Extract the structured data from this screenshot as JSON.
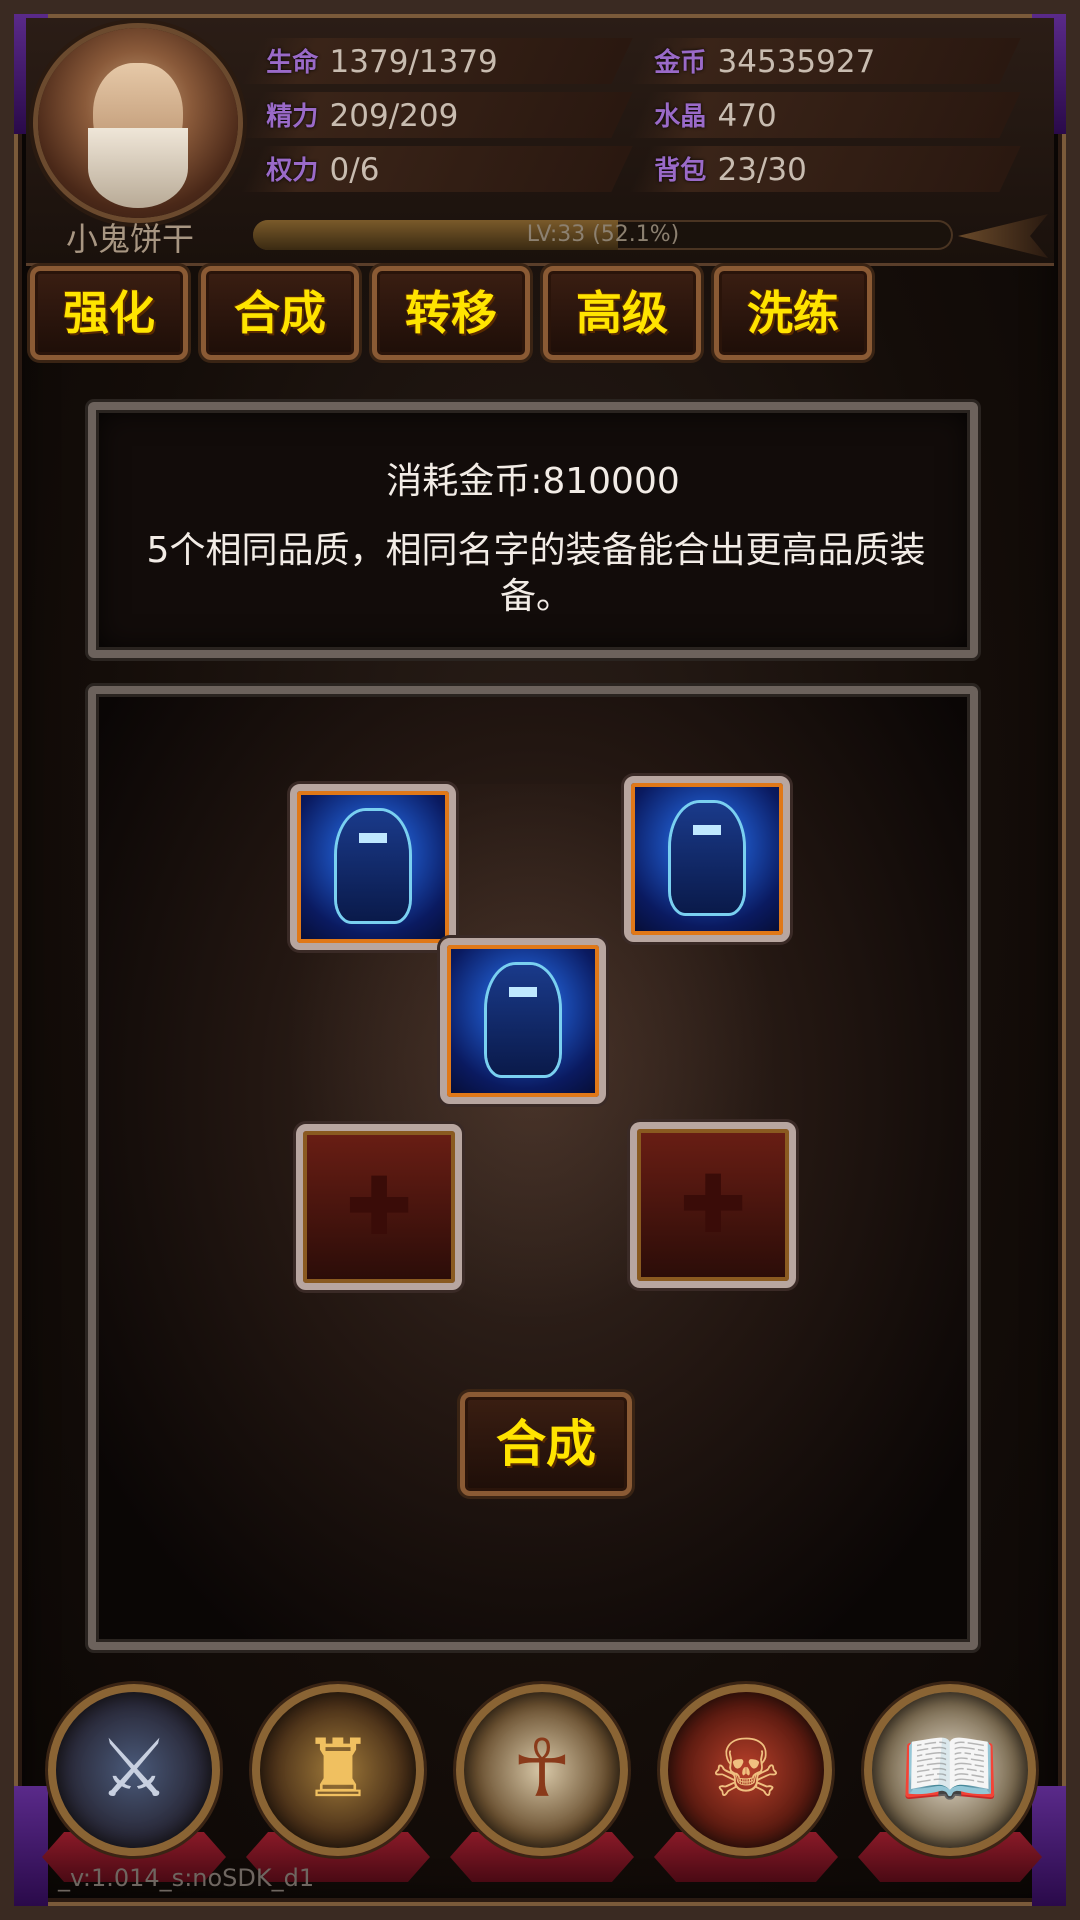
{
  "player": {
    "name": "小鬼饼干",
    "level_text": "LV:33 (52.1%)",
    "level_progress": 0.521
  },
  "stats": [
    {
      "label": "生命",
      "value": "1379/1379"
    },
    {
      "label": "精力",
      "value": "209/209"
    },
    {
      "label": "权力",
      "value": "0/6"
    },
    {
      "label": "金币",
      "value": "34535927"
    },
    {
      "label": "水晶",
      "value": "470"
    },
    {
      "label": "背包",
      "value": "23/30"
    }
  ],
  "tabs": [
    "强化",
    "合成",
    "转移",
    "高级",
    "洗练"
  ],
  "info": {
    "cost": "消耗金币:810000",
    "description": "5个相同品质，相同名字的装备能合出更高品质装备。"
  },
  "slots": {
    "filled_icon": "blue-armor-icon",
    "empty_icon": "plus-icon"
  },
  "synth_button": "合成",
  "bottom_nav": [
    {
      "icon": "shield-crest-icon"
    },
    {
      "icon": "golden-helmet-icon"
    },
    {
      "icon": "mask-idol-icon"
    },
    {
      "icon": "treasure-chest-icon"
    },
    {
      "icon": "book-magnifier-icon"
    }
  ],
  "version": "_v:1.014_s:noSDK_d1",
  "colors": {
    "tab_text": "#ffe400",
    "stat_label": "#9a6ac8",
    "slot_border": "#e07818"
  }
}
